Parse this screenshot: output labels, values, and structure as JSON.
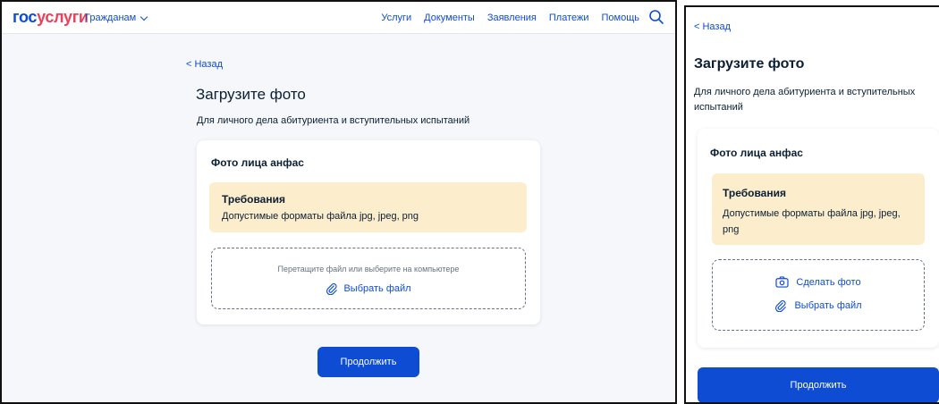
{
  "header": {
    "logo_part1": "гос",
    "logo_part2": "услуги",
    "citizens_label": "Гражданам",
    "nav": [
      "Услуги",
      "Документы",
      "Заявления",
      "Платежи",
      "Помощь"
    ]
  },
  "back_label": "< Назад",
  "page_title": "Загрузите фото",
  "page_subtitle": "Для личного дела абитуриента и вступительных испытаний",
  "card": {
    "title": "Фото лица анфас",
    "requirements_title": "Требования",
    "requirements_text": "Допустимые форматы файла jpg, jpeg, png",
    "drop_hint": "Перетащите файл или выберите на компьютере",
    "choose_file_label": "Выбрать файл",
    "take_photo_label": "Сделать фото"
  },
  "continue_label": "Продолжить",
  "colors": {
    "accent": "#0d4cd3",
    "brand_red": "#ee3f58",
    "requirements_bg": "#fcedcd",
    "page_bg": "#f5f7fa"
  },
  "icons": [
    "chevron-down-icon",
    "search-icon",
    "paperclip-icon",
    "camera-icon"
  ]
}
